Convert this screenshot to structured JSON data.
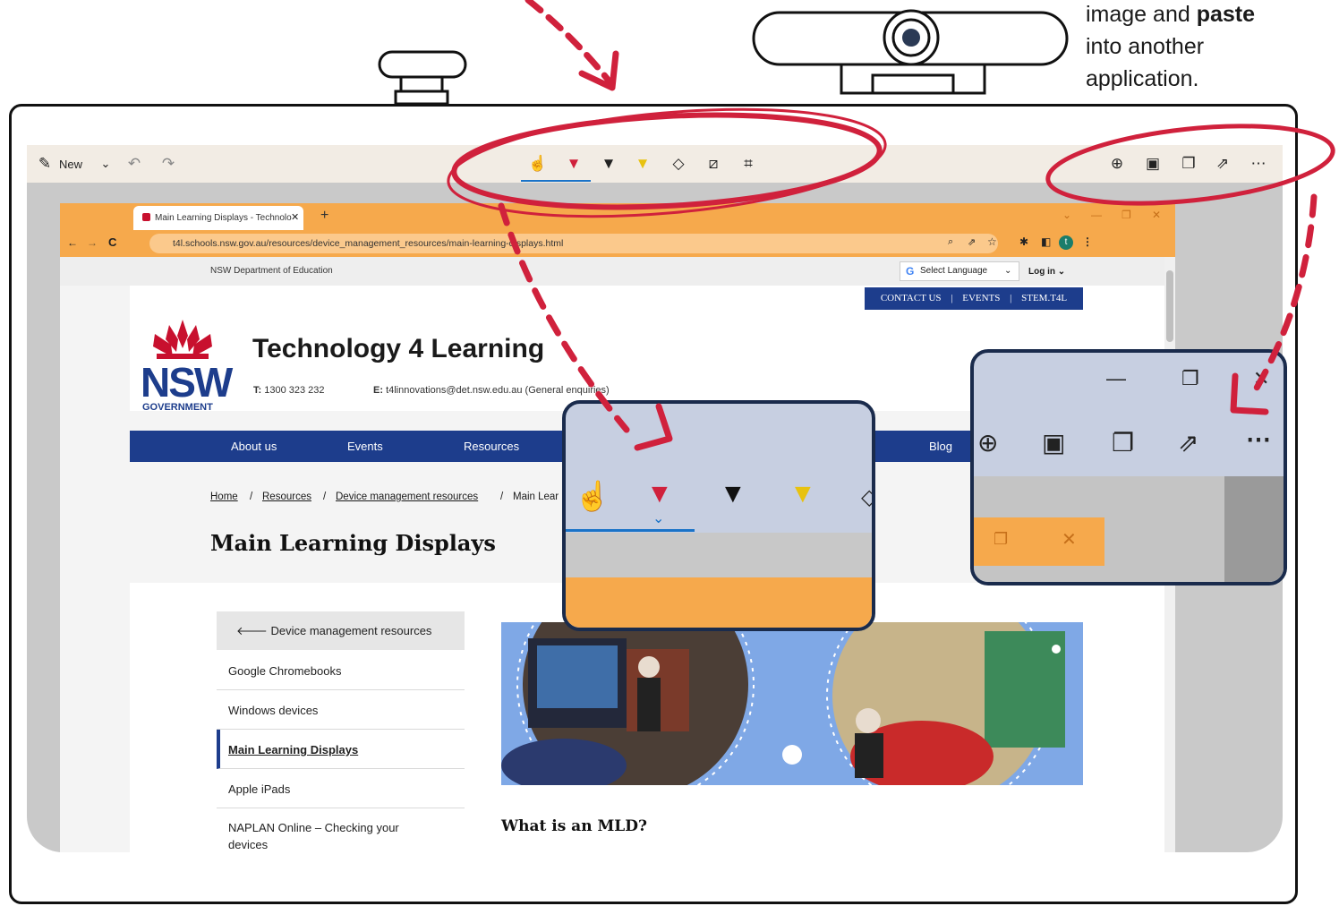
{
  "note": {
    "line1_pre": "image and ",
    "line1_bold": "paste",
    "line2": "into another",
    "line3": "application."
  },
  "snip_toolbar": {
    "new_label": "New",
    "icons": [
      "new-icon",
      "chevron-down-icon",
      "undo-icon",
      "redo-icon",
      "touch-writing-icon",
      "ballpoint-pen-red-icon",
      "ballpoint-pen-black-icon",
      "highlighter-icon",
      "eraser-icon",
      "ruler-icon",
      "crop-icon",
      "zoom-icon",
      "save-icon",
      "copy-icon",
      "share-icon",
      "more-icon"
    ]
  },
  "browser": {
    "tab_title": "Main Learning Displays - Technolo",
    "url": "t4l.schools.nsw.gov.au/resources/device_management_resources/main-learning-displays.html",
    "profile_initial": "t"
  },
  "page": {
    "utility_text": "NSW Department of Education",
    "select_language": "Select Language",
    "login": "Log in",
    "top_links": [
      "CONTACT US",
      "EVENTS",
      "STEM.T4L"
    ],
    "logo_nsw": "NSW",
    "logo_government": "GOVERNMENT",
    "site_title": "Technology 4 Learning",
    "phone_label": "T:",
    "phone": "1300 323 232",
    "email_label": "E:",
    "email": "t4linnovations@det.nsw.edu.au (General enquiries)",
    "nav": [
      "About us",
      "Events",
      "Resources",
      "Blog"
    ],
    "breadcrumb": [
      "Home",
      "Resources",
      "Device management resources",
      "Main Lear"
    ],
    "title": "Main Learning Displays",
    "sidebar_back": "Device management resources",
    "sidebar_items": [
      "Google Chromebooks",
      "Windows devices",
      "Main Learning Displays",
      "Apple iPads",
      "NAPLAN Online – Checking your devices"
    ],
    "section_heading": "What is an MLD?"
  },
  "colors": {
    "nsw_blue": "#1d3d8c",
    "tab_orange": "#f6a94c",
    "annotation_red": "#d0213c"
  }
}
